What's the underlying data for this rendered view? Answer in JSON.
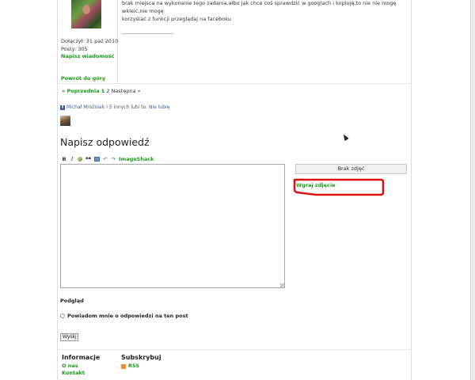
{
  "post": {
    "author": {
      "joined": "Dołączył: 31 paź 2010",
      "posts": "Posty: 305",
      "send_message": "Napisz wiadomość",
      "back_to_top": "Powrót do góry"
    },
    "text_line1": "brak miejsca na wykonanie tego zadania,albo jak chce coś sprawdzić w googlach i kopiuję,to nie nie mogę wkleić,nie mogę",
    "text_line2": "korzystać z funkcji przeglądaj na faceboku"
  },
  "pagination": {
    "prev": "« Poprzednia",
    "page1": "1",
    "page2": "2",
    "next": "Następna »"
  },
  "facebook": {
    "icon": "f",
    "name": "Michał Mroźniak",
    "likes_text": "i 5 innych lubi to.",
    "unlike": "Nie lubię"
  },
  "reply": {
    "title": "Napisz odpowiedź",
    "toolbar": {
      "bold": "B",
      "italic": "I",
      "quote": "❝❝",
      "undo": "↶",
      "redo": "↷",
      "imageshack": "ImageShack"
    },
    "textarea_value": "",
    "no_images": "Brak zdjęć",
    "upload": "Wgraj zdjęcie",
    "preview": "Podgląd",
    "notify": "Powiadom mnie o odpowiedzi na ten post",
    "submit": "Wyślij"
  },
  "footer": {
    "info_title": "Informacje",
    "about": "O nas",
    "contact": "Kontakt",
    "subscribe_title": "Subskrybuj",
    "rss": "RSS"
  },
  "colors": {
    "link_green": "#1a9a1a",
    "annotation_red": "#e01010",
    "facebook_blue": "#3b5998"
  }
}
